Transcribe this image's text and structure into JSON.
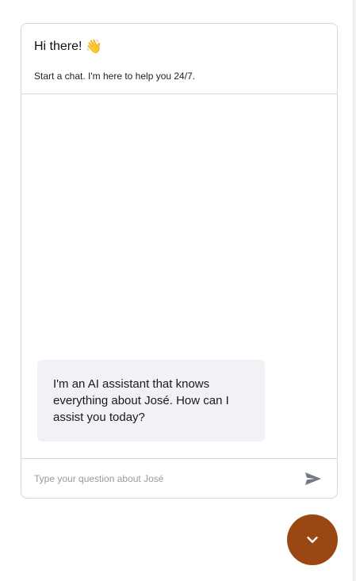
{
  "header": {
    "title": "Hi there!",
    "wave_icon": "👋",
    "subtitle": "Start a chat. I'm here to help you 24/7."
  },
  "messages": [
    {
      "role": "assistant",
      "text": "I'm an AI assistant that knows everything about José. How can I assist you today?"
    }
  ],
  "input": {
    "placeholder": "Type your question about José",
    "value": ""
  },
  "icons": {
    "send": "send-icon",
    "toggle": "chevron-down-icon"
  },
  "colors": {
    "accent": "#9a4713",
    "bubble": "#f1f2f5",
    "border": "#d7d7d7",
    "send_icon": "#747a82"
  }
}
